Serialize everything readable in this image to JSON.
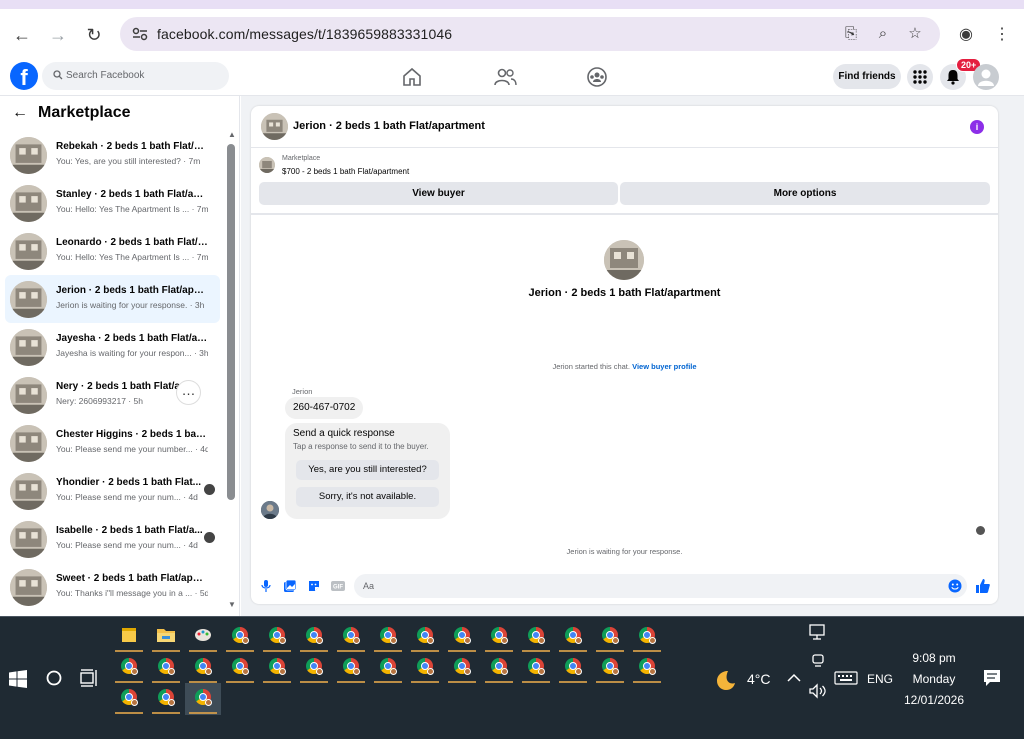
{
  "browser": {
    "url": "facebook.com/messages/t/1839659883331046"
  },
  "facebook": {
    "search_placeholder": "Search Facebook",
    "find_friends": "Find friends",
    "notification_count": "20+"
  },
  "sidebar": {
    "title": "Marketplace",
    "conversations": [
      {
        "name": "Rebekah · 2 beds 1 bath Flat/ap...",
        "preview": "You: Yes, are you still interested? · 7m"
      },
      {
        "name": "Stanley · 2 beds 1 bath Flat/apa...",
        "preview": "You: Hello: Yes The Apartment Is ... · 7m"
      },
      {
        "name": "Leonardo · 2 beds 1 bath Flat/a...",
        "preview": "You: Hello: Yes The Apartment Is ... · 7m"
      },
      {
        "name": "Jerion · 2 beds 1 bath Flat/apar...",
        "preview": "Jerion is waiting for your response. · 3h"
      },
      {
        "name": "Jayesha · 2 beds 1 bath Flat/ap...",
        "preview": "Jayesha is waiting for your respon... · 3h"
      },
      {
        "name": "Nery · 2 beds 1 bath Flat/ap...",
        "preview": "Nery: 2606993217 · 5h"
      },
      {
        "name": "Chester Higgins · 2 beds 1 bath...",
        "preview": "You: Please send me your number... · 4d"
      },
      {
        "name": "Yhondier · 2 beds 1 bath Flat...",
        "preview": "You: Please send me your num... · 4d"
      },
      {
        "name": "Isabelle · 2 beds 1 bath Flat/a...",
        "preview": "You: Please send me your num... · 4d"
      },
      {
        "name": "Sweet · 2 beds 1 bath Flat/apar...",
        "preview": "You: Thanks i\"ll message you in a ... · 5d"
      }
    ]
  },
  "chat": {
    "header_title": "Jerion · 2 beds 1 bath Flat/apartment",
    "marketplace_label": "Marketplace",
    "listing": "$700 - 2 beds 1 bath Flat/apartment",
    "view_buyer": "View buyer",
    "more_options": "More options",
    "center_name": "Jerion · 2 beds 1 bath Flat/apartment",
    "started_text": "Jerion started this chat.",
    "view_buyer_profile": "View buyer profile",
    "sender": "Jerion",
    "message": "260-467-0702",
    "quick_title": "Send a quick response",
    "quick_sub": "Tap a response to send it to the buyer.",
    "quick_1": "Yes, are you still interested?",
    "quick_2": "Sorry, it's not available.",
    "waiting": "Jerion is waiting for your response.",
    "composer_placeholder": "Aa"
  },
  "taskbar": {
    "weather": "4°C",
    "language": "ENG",
    "time": "9:08 pm",
    "day": "Monday",
    "date": "12/01/2026"
  },
  "colors": {
    "fb_blue": "#0866ff",
    "info_purple": "#8c2ee8",
    "active_conv": "#ebf5ff",
    "taskbar": "#1f2a33"
  }
}
